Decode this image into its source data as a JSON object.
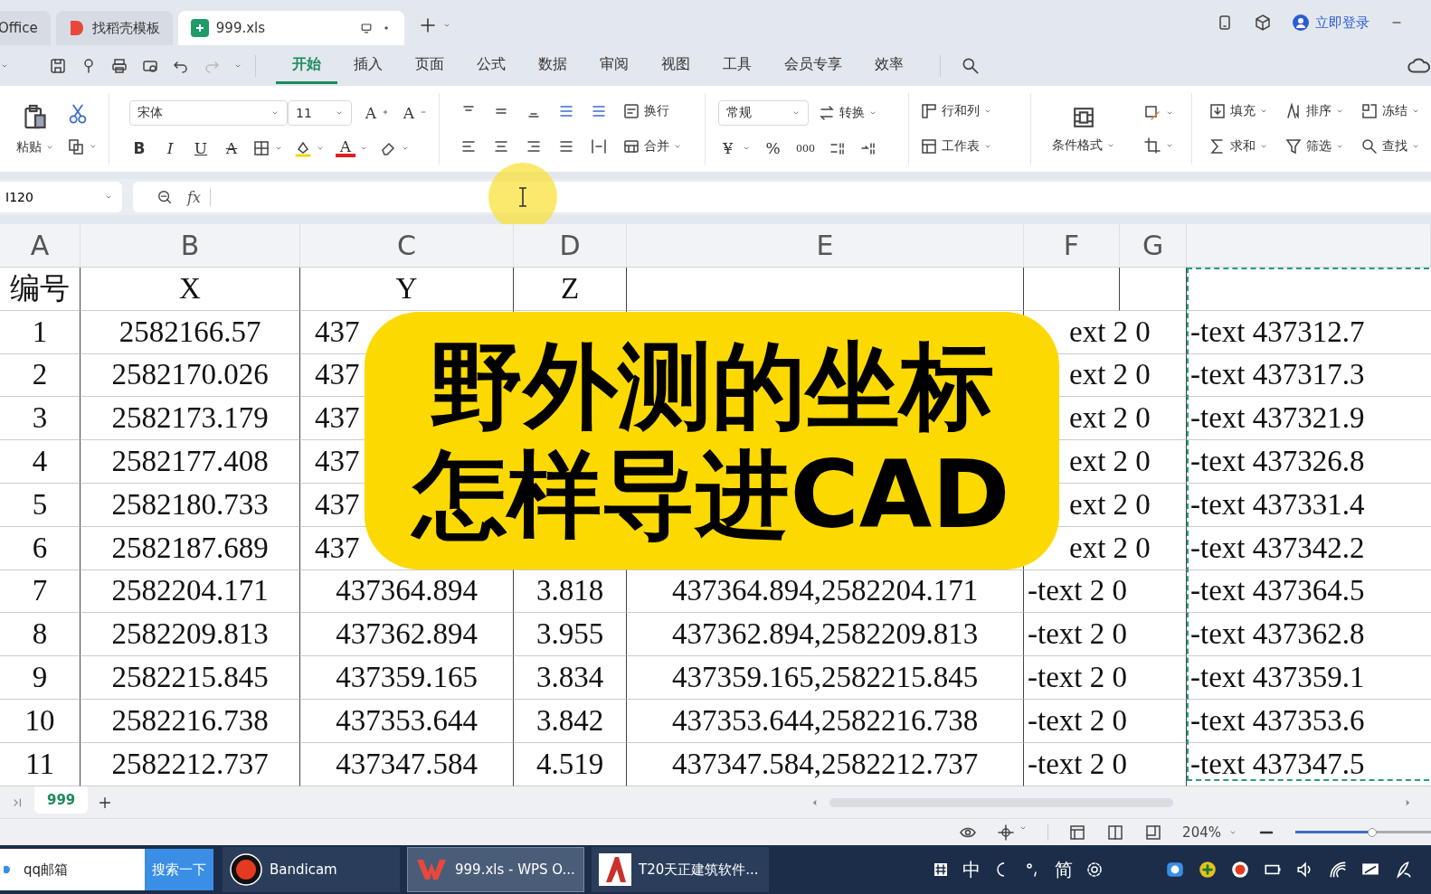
{
  "tabs": [
    {
      "label": "Office",
      "kind": "office",
      "selected": false
    },
    {
      "label": "找稻壳模板",
      "kind": "docer",
      "selected": false
    },
    {
      "label": "999.xls",
      "kind": "sheet",
      "selected": true
    }
  ],
  "account": {
    "label": "立即登录"
  },
  "menu": [
    {
      "label": "开始",
      "selected": true
    },
    {
      "label": "插入",
      "selected": false
    },
    {
      "label": "页面",
      "selected": false
    },
    {
      "label": "公式",
      "selected": false
    },
    {
      "label": "数据",
      "selected": false
    },
    {
      "label": "审阅",
      "selected": false
    },
    {
      "label": "视图",
      "selected": false
    },
    {
      "label": "工具",
      "selected": false
    },
    {
      "label": "会员专享",
      "selected": false
    },
    {
      "label": "效率",
      "selected": false
    }
  ],
  "ribbon": {
    "paste": "粘贴",
    "font_name": "宋体",
    "font_size": "11",
    "grow_font": "A",
    "shrink_font": "A",
    "bold": "B",
    "italic": "I",
    "underline": "U",
    "strike": "A",
    "font_color": "A",
    "wrap": "换行",
    "merge": "合并",
    "number_format": "常规",
    "convert": "转换",
    "currency": "¥",
    "percent": "%",
    "thousands": "000",
    "rows_cols": "行和列",
    "worksheet": "工作表",
    "cond_format": "条件格式",
    "fill": "填充",
    "sort": "排序",
    "freeze": "冻结",
    "sum": "求和",
    "filter": "筛选",
    "find": "查找"
  },
  "formula_bar": {
    "name_box": "I120",
    "fx_label": "fx"
  },
  "columns": [
    {
      "letter": "A"
    },
    {
      "letter": "B"
    },
    {
      "letter": "C"
    },
    {
      "letter": "D"
    },
    {
      "letter": "E"
    },
    {
      "letter": "F"
    },
    {
      "letter": "G"
    }
  ],
  "rows": [
    {
      "A": "编号",
      "B": "X",
      "C": "Y",
      "D": "Z"
    },
    {
      "A": "1",
      "B": "2582166.57",
      "C": "437",
      "F": "ext 2 0",
      "column_8": "-text 437312.7"
    },
    {
      "A": "2",
      "B": "2582170.026",
      "C": "437",
      "F": "ext 2 0",
      "column_8": "-text 437317.3"
    },
    {
      "A": "3",
      "B": "2582173.179",
      "C": "437",
      "F": "ext 2 0",
      "column_8": "-text 437321.9"
    },
    {
      "A": "4",
      "B": "2582177.408",
      "C": "437",
      "F": "ext 2 0",
      "column_8": "-text 437326.8"
    },
    {
      "A": "5",
      "B": "2582180.733",
      "C": "437",
      "F": "ext 2 0",
      "column_8": "-text 437331.4"
    },
    {
      "A": "6",
      "B": "2582187.689",
      "C": "437",
      "F": "ext 2 0",
      "column_8": "-text 437342.2"
    },
    {
      "A": "7",
      "B": "2582204.171",
      "C": "437364.894",
      "D": "3.818",
      "E": "437364.894,2582204.171",
      "F": "-text 2 0",
      "column_8": "-text 437364.5"
    },
    {
      "A": "8",
      "B": "2582209.813",
      "C": "437362.894",
      "D": "3.955",
      "E": "437362.894,2582209.813",
      "F": "-text 2 0",
      "column_8": "-text 437362.8"
    },
    {
      "A": "9",
      "B": "2582215.845",
      "C": "437359.165",
      "D": "3.834",
      "E": "437359.165,2582215.845",
      "F": "-text 2 0",
      "column_8": "-text 437359.1"
    },
    {
      "A": "10",
      "B": "2582216.738",
      "C": "437353.644",
      "D": "3.842",
      "E": "437353.644,2582216.738",
      "F": "-text 2 0",
      "column_8": "-text 437353.6"
    },
    {
      "A": "11",
      "B": "2582212.737",
      "C": "437347.584",
      "D": "4.519",
      "E": "437347.584,2582212.737",
      "F": "-text 2 0",
      "column_8": "-text 437347.5"
    }
  ],
  "copy_marquee": {
    "visible": true
  },
  "title_overlay": {
    "lines": [
      "野外测的坐标",
      "怎样导进CAD"
    ]
  },
  "sheet_tabs": [
    {
      "label": "999",
      "selected": true
    }
  ],
  "status_bar": {
    "zoom": "204%",
    "zoom_slider": {
      "level": 0.6
    }
  },
  "taskbar": {
    "search": {
      "value": "qq邮箱",
      "button": "搜索一下"
    },
    "apps": [
      {
        "label": "Bandicam",
        "kind": "recorder",
        "selected": false
      },
      {
        "label": "999.xls - WPS O...",
        "kind": "wps",
        "selected": true
      },
      {
        "label": "T20天正建筑软件...",
        "kind": "cad",
        "selected": false
      }
    ],
    "ime": [
      "中",
      "简"
    ]
  }
}
